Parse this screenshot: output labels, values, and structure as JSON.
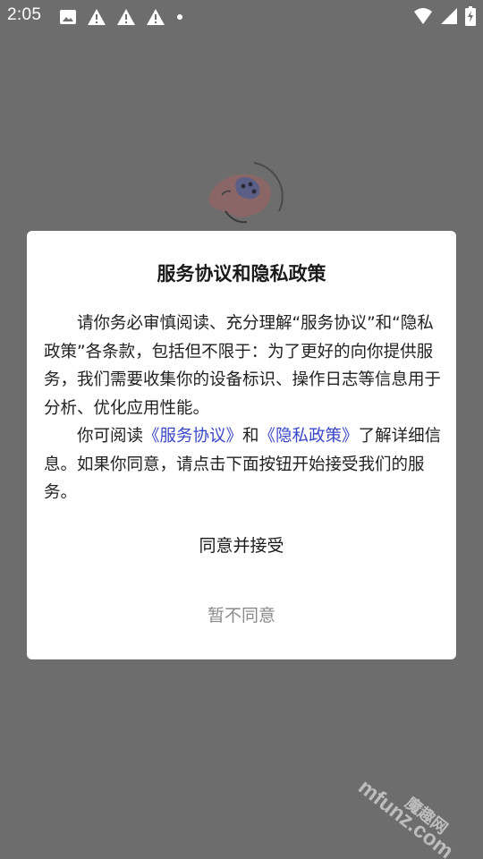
{
  "status_bar": {
    "time": "2:05",
    "left_icons": [
      "image-icon",
      "alert-icon",
      "alert-icon",
      "alert-icon",
      "dot-icon"
    ],
    "right_icons": [
      "wifi-icon",
      "cell-signal-icon",
      "battery-charging-icon"
    ]
  },
  "dialog": {
    "title": "服务协议和隐私政策",
    "paragraph1": "请你务必审慎阅读、充分理解“服务协议”和“隐私政策”各条款，包括但不限于：为了更好的向你提供服务，我们需要收集你的设备标识、操作日志等信息用于分析、优化应用性能。",
    "paragraph2_prefix": "你可阅读",
    "service_link": "《服务协议》",
    "paragraph2_and": "和",
    "privacy_link": "《隐私政策》",
    "paragraph2_suffix": "了解详细信息。如果你同意，请点击下面按钮开始接受我们的服务。",
    "agree_label": "同意并接受",
    "disagree_label": "暂不同意"
  },
  "watermark": {
    "cn": "魔趣网",
    "en": "mfunz.com"
  },
  "colors": {
    "overlay": "#6d6d6d",
    "link": "#3a47c9",
    "secondary_text": "#8a8a8a"
  }
}
